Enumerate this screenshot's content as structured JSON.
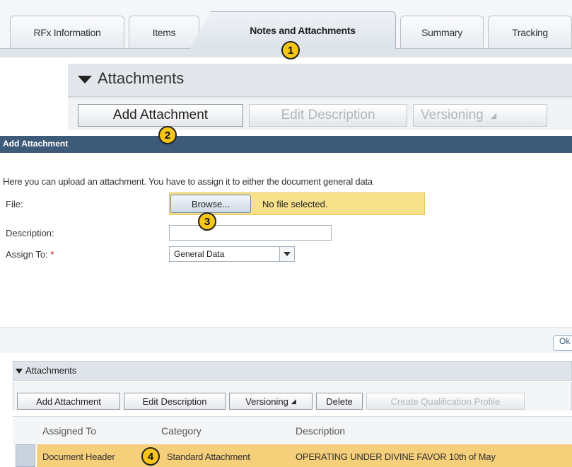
{
  "tabs": [
    {
      "label": "RFx Information",
      "active": false
    },
    {
      "label": "Items",
      "active": false
    },
    {
      "label": "Notes and Attachments",
      "active": true
    },
    {
      "label": "Summary",
      "active": false
    },
    {
      "label": "Tracking",
      "active": false
    }
  ],
  "steps": [
    "1",
    "2",
    "3",
    "4"
  ],
  "attachments_panel": {
    "title": "Attachments",
    "buttons": {
      "add": "Add Attachment",
      "edit": "Edit Description",
      "versioning": "Versioning"
    }
  },
  "dialog": {
    "title": "Add Attachment",
    "info": "Here you can upload an attachment. You have to assign it to either the document general data",
    "file_label": "File:",
    "browse_label": "Browse...",
    "no_file_text": "No file selected.",
    "description_label": "Description:",
    "description_value": "",
    "assign_label": "Assign To:",
    "required_mark": "*",
    "assign_value": "General Data",
    "footer_button": "Ok"
  },
  "bottom_panel": {
    "title": "Attachments",
    "buttons": {
      "add": "Add Attachment",
      "edit": "Edit Description",
      "versioning": "Versioning",
      "delete": "Delete",
      "create_qualification": "Create Qualification Profile"
    },
    "columns": [
      "Assigned To",
      "Category",
      "Description"
    ],
    "rows": [
      {
        "assigned_to": "Document Header",
        "category": "Standard Attachment",
        "description": "OPERATING UNDER DIVINE FAVOR 10th of May"
      }
    ]
  },
  "colors": {
    "badge": "#f5c518",
    "dialog_titlebar": "#3d5a78",
    "file_highlight": "#f7e08a",
    "row_highlight": "#f5cf7a"
  }
}
